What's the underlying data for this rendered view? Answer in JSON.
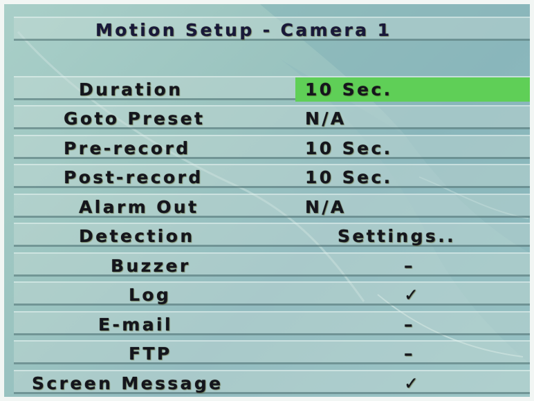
{
  "menu": {
    "title": "Motion Setup - Camera 1",
    "rows": [
      {
        "label": "Duration",
        "value": "10 Sec."
      },
      {
        "label": "Goto Preset",
        "value": "N/A"
      },
      {
        "label": "Pre-record",
        "value": "10 Sec."
      },
      {
        "label": "Post-record",
        "value": "10 Sec."
      },
      {
        "label": "Alarm Out",
        "value": "N/A"
      },
      {
        "label": "Detection",
        "value": "Settings.."
      },
      {
        "label": "Buzzer",
        "value": "–"
      },
      {
        "label": "Log",
        "value": "✓"
      },
      {
        "label": "E-mail",
        "value": "–"
      },
      {
        "label": "FTP",
        "value": "–"
      },
      {
        "label": "Screen Message",
        "value": "✓"
      }
    ]
  },
  "colors": {
    "highlight": "#5fcf57",
    "text": "#14151d",
    "background": "#9bc4c0"
  }
}
